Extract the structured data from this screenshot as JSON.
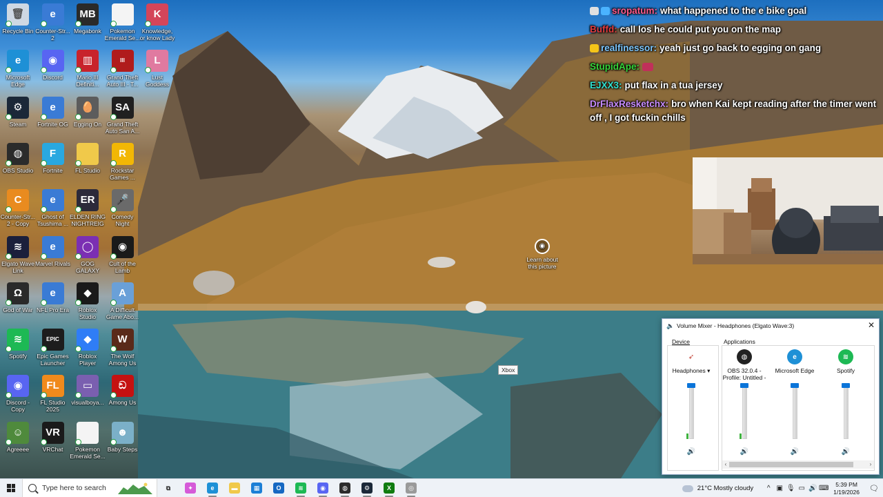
{
  "desktop": {
    "icons": [
      {
        "label": "Recycle Bin",
        "icon": "recycle-bin-icon",
        "color": "#cfd8e3",
        "glyph": "🗑",
        "col": 0,
        "row": 0
      },
      {
        "label": "Counter-Str... 2",
        "icon": "counter-strike-icon",
        "color": "#3a7bd5",
        "glyph": "e",
        "col": 1,
        "row": 0
      },
      {
        "label": "Megabonk",
        "icon": "megabonk-icon",
        "color": "#2a2a2a",
        "glyph": "MB",
        "col": 2,
        "row": 0
      },
      {
        "label": "Pokemon Emerald Se...",
        "icon": "file-icon",
        "color": "#f4f4f4",
        "glyph": "",
        "col": 3,
        "row": 0
      },
      {
        "label": "Knowledge, or know Lady",
        "icon": "knowledge-icon",
        "color": "#d4455a",
        "glyph": "K",
        "col": 4,
        "row": 0
      },
      {
        "label": "Microsoft Edge",
        "icon": "edge-icon",
        "color": "#1e90d6",
        "glyph": "e",
        "col": 0,
        "row": 1
      },
      {
        "label": "Discord",
        "icon": "discord-icon",
        "color": "#5865f2",
        "glyph": "◉",
        "col": 1,
        "row": 1
      },
      {
        "label": "Mario III Definiti...",
        "icon": "mario-icon",
        "color": "#c8232c",
        "glyph": "▥",
        "col": 2,
        "row": 1
      },
      {
        "label": "Grand Theft Auto III - T...",
        "icon": "gta-icon",
        "color": "#b01c1c",
        "glyph": "III",
        "col": 3,
        "row": 1
      },
      {
        "label": "Lust Goddess",
        "icon": "lust-goddess-icon",
        "color": "#e07aa0",
        "glyph": "L",
        "col": 4,
        "row": 1
      },
      {
        "label": "Steam",
        "icon": "steam-icon",
        "color": "#1b2838",
        "glyph": "⚙",
        "col": 0,
        "row": 2
      },
      {
        "label": "Fortnite OG",
        "icon": "fortnite-og-icon",
        "color": "#3a7bd5",
        "glyph": "e",
        "col": 1,
        "row": 2
      },
      {
        "label": "Egging On",
        "icon": "egging-on-icon",
        "color": "#5c5c5c",
        "glyph": "🥚",
        "col": 2,
        "row": 2
      },
      {
        "label": "Grand Theft Auto San A...",
        "icon": "gta-sa-icon",
        "color": "#202020",
        "glyph": "SA",
        "col": 3,
        "row": 2
      },
      {
        "label": "OBS Studio",
        "icon": "obs-icon",
        "color": "#2b2b2b",
        "glyph": "◍",
        "col": 0,
        "row": 3
      },
      {
        "label": "Fortnite",
        "icon": "fortnite-icon",
        "color": "#29a8e0",
        "glyph": "F",
        "col": 1,
        "row": 3
      },
      {
        "label": "FL Studio",
        "icon": "folder-icon",
        "color": "#f0c94a",
        "glyph": "",
        "col": 2,
        "row": 3
      },
      {
        "label": "Rockstar Games ...",
        "icon": "rockstar-icon",
        "color": "#f2b705",
        "glyph": "R",
        "col": 3,
        "row": 3
      },
      {
        "label": "Counter-Str... 2 - Copy",
        "icon": "cs2-icon",
        "color": "#e98b1f",
        "glyph": "C",
        "col": 0,
        "row": 4
      },
      {
        "label": "Ghost of Tsushima ...",
        "icon": "ghost-icon",
        "color": "#3a7bd5",
        "glyph": "e",
        "col": 1,
        "row": 4
      },
      {
        "label": "ELDEN RING NIGHTREIGN",
        "icon": "elden-ring-icon",
        "color": "#2c2a3a",
        "glyph": "ER",
        "col": 2,
        "row": 4
      },
      {
        "label": "Comedy Night",
        "icon": "comedy-night-icon",
        "color": "#6a6a6a",
        "glyph": "🎤",
        "col": 3,
        "row": 4
      },
      {
        "label": "Elgato Wave Link",
        "icon": "elgato-icon",
        "color": "#1b1f3b",
        "glyph": "≋",
        "col": 0,
        "row": 5
      },
      {
        "label": "Marvel Rivals",
        "icon": "marvel-rivals-icon",
        "color": "#3a7bd5",
        "glyph": "e",
        "col": 1,
        "row": 5
      },
      {
        "label": "GOG GALAXY",
        "icon": "gog-icon",
        "color": "#7b2fb3",
        "glyph": "◯",
        "col": 2,
        "row": 5
      },
      {
        "label": "Cult of the Lamb",
        "icon": "cult-of-lamb-icon",
        "color": "#1a1a1a",
        "glyph": "◉",
        "col": 3,
        "row": 5
      },
      {
        "label": "God of War",
        "icon": "god-of-war-icon",
        "color": "#2a2a2a",
        "glyph": "Ω",
        "col": 0,
        "row": 6
      },
      {
        "label": "NFL Pro Era",
        "icon": "nfl-icon",
        "color": "#3a7bd5",
        "glyph": "e",
        "col": 1,
        "row": 6
      },
      {
        "label": "Roblox Studio",
        "icon": "roblox-studio-icon",
        "color": "#1a1a1a",
        "glyph": "◆",
        "col": 2,
        "row": 6
      },
      {
        "label": "A Difficult Game Abo...",
        "icon": "difficult-game-icon",
        "color": "#6aa0d8",
        "glyph": "A",
        "col": 3,
        "row": 6
      },
      {
        "label": "Spotify",
        "icon": "spotify-icon",
        "color": "#1db954",
        "glyph": "≋",
        "col": 0,
        "row": 7
      },
      {
        "label": "Epic Games Launcher",
        "icon": "epic-icon",
        "color": "#1d1d1d",
        "glyph": "EPIC",
        "col": 1,
        "row": 7
      },
      {
        "label": "Roblox Player",
        "icon": "roblox-icon",
        "color": "#2f7df6",
        "glyph": "◆",
        "col": 2,
        "row": 7
      },
      {
        "label": "The Wolf Among Us",
        "icon": "wolf-icon",
        "color": "#5a2a1a",
        "glyph": "W",
        "col": 3,
        "row": 7
      },
      {
        "label": "Discord - Copy",
        "icon": "discord-copy-icon",
        "color": "#5865f2",
        "glyph": "◉",
        "col": 0,
        "row": 8
      },
      {
        "label": "FL Studio 2025",
        "icon": "fl-studio-icon",
        "color": "#f08a1c",
        "glyph": "FL",
        "col": 1,
        "row": 8
      },
      {
        "label": "visualboya...",
        "icon": "vba-icon",
        "color": "#7a5fb0",
        "glyph": "▭",
        "col": 2,
        "row": 8
      },
      {
        "label": "Among Us",
        "icon": "among-us-icon",
        "color": "#c51111",
        "glyph": "ඞ",
        "col": 3,
        "row": 8
      },
      {
        "label": "Agreeee",
        "icon": "agreeee-icon",
        "color": "#4f8a3c",
        "glyph": "☺",
        "col": 0,
        "row": 9
      },
      {
        "label": "VRChat",
        "icon": "vrchat-icon",
        "color": "#1a1a1a",
        "glyph": "VR",
        "col": 1,
        "row": 9
      },
      {
        "label": "Pokemon Emerald Se...",
        "icon": "file-icon",
        "color": "#f4f4f4",
        "glyph": "",
        "col": 2,
        "row": 9
      },
      {
        "label": "Baby Steps",
        "icon": "baby-steps-icon",
        "color": "#7bb0c8",
        "glyph": "☻",
        "col": 3,
        "row": 9
      }
    ]
  },
  "chat": {
    "messages": [
      {
        "user": "sropatum:",
        "text": "what happened to the e bike goal",
        "color": "#ff5a8a",
        "badges": [
          "#e0e0e0",
          "#4ab3ff"
        ]
      },
      {
        "user": "Buffd:",
        "text": "call los he could put you on the map",
        "color": "#e23b3b",
        "badges": []
      },
      {
        "user": "realfinessor:",
        "text": "yeah just go back to egging on gang",
        "color": "#7cc7ff",
        "badges": [
          "#f5c518"
        ]
      },
      {
        "user": "StupidApe:",
        "text": "",
        "color": "#35d43a",
        "badges": [],
        "emote": true
      },
      {
        "user": "EJXX3:",
        "text": "put flax in a tua jersey",
        "color": "#30e0d0",
        "badges": []
      },
      {
        "user": "DrFlaxResketchx:",
        "text": "bro when Kai kept reading after the timer went off , I got fuckin chills",
        "color": "#c78cff",
        "badges": []
      }
    ]
  },
  "learn_picture": {
    "label": "Learn about this picture"
  },
  "xbox_tooltip": "Xbox",
  "mixer": {
    "title": "Volume Mixer - Headphones (Elgato Wave:3)",
    "device_label": "Device",
    "applications_label": "Applications",
    "device": {
      "name": "Headphones",
      "level": 1.0,
      "meter": 0.1
    },
    "apps": [
      {
        "name": "OBS 32.0.4 - Profile: Untitled - ...",
        "icon": "obs-icon",
        "color": "#222222",
        "level": 1.0,
        "meter": 0.1
      },
      {
        "name": "Microsoft Edge",
        "icon": "edge-icon",
        "color": "#1e90d6",
        "level": 1.0,
        "meter": 0.0
      },
      {
        "name": "Spotify",
        "icon": "spotify-icon",
        "color": "#1db954",
        "level": 1.0,
        "meter": 0.0
      }
    ]
  },
  "taskbar": {
    "search_placeholder": "Type here to search",
    "apps": [
      {
        "name": "task-view",
        "glyph": "⧉",
        "color": "#333333",
        "running": false
      },
      {
        "name": "copilot",
        "glyph": "✦",
        "color": "#d55ad8",
        "running": false
      },
      {
        "name": "edge",
        "glyph": "e",
        "color": "#1e90d6",
        "running": true
      },
      {
        "name": "file-explorer",
        "glyph": "▬",
        "color": "#f0c94a",
        "running": false
      },
      {
        "name": "microsoft-store",
        "glyph": "▦",
        "color": "#1c7fd6",
        "running": false
      },
      {
        "name": "outlook",
        "glyph": "O",
        "color": "#1668c2",
        "running": false
      },
      {
        "name": "spotify",
        "glyph": "≋",
        "color": "#1db954",
        "running": true
      },
      {
        "name": "discord",
        "glyph": "◉",
        "color": "#5865f2",
        "running": true
      },
      {
        "name": "obs",
        "glyph": "◍",
        "color": "#2b2b2b",
        "running": true
      },
      {
        "name": "steam",
        "glyph": "⚙",
        "color": "#1b2838",
        "running": true
      },
      {
        "name": "xbox",
        "glyph": "X",
        "color": "#107c10",
        "running": true
      },
      {
        "name": "unknown-app",
        "glyph": "◎",
        "color": "#9a9a9a",
        "running": true
      }
    ],
    "weather": "21°C  Mostly cloudy",
    "time": "5:39 PM",
    "date": "1/19/2026"
  }
}
